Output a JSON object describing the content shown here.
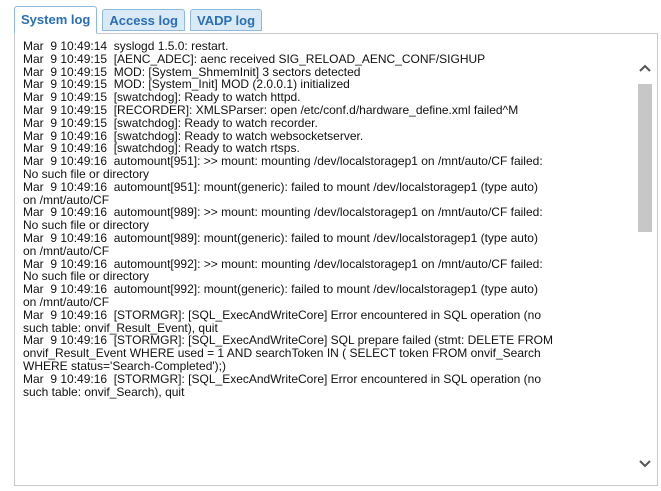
{
  "tabs": [
    {
      "label": "System log",
      "active": true
    },
    {
      "label": "Access log",
      "active": false
    },
    {
      "label": "VADP log",
      "active": false
    }
  ],
  "log_lines": [
    "Mar  9 10:49:14  syslogd 1.5.0: restart.",
    "Mar  9 10:49:15  [AENC_ADEC]: aenc received SIG_RELOAD_AENC_CONF/SIGHUP",
    "Mar  9 10:49:15  MOD: [System_ShmemInit] 3 sectors detected",
    "Mar  9 10:49:15  MOD: [System_Init] MOD (2.0.0.1) initialized",
    "Mar  9 10:49:15  [swatchdog]: Ready to watch httpd.",
    "Mar  9 10:49:15  [RECORDER]: XMLSParser: open /etc/conf.d/hardware_define.xml failed^M",
    "Mar  9 10:49:15  [swatchdog]: Ready to watch recorder.",
    "Mar  9 10:49:16  [swatchdog]: Ready to watch websocketserver.",
    "Mar  9 10:49:16  [swatchdog]: Ready to watch rtsps.",
    "Mar  9 10:49:16  automount[951]: >> mount: mounting /dev/localstoragep1 on /mnt/auto/CF failed:",
    "No such file or directory",
    "Mar  9 10:49:16  automount[951]: mount(generic): failed to mount /dev/localstoragep1 (type auto)",
    "on /mnt/auto/CF",
    "Mar  9 10:49:16  automount[989]: >> mount: mounting /dev/localstoragep1 on /mnt/auto/CF failed:",
    "No such file or directory",
    "Mar  9 10:49:16  automount[989]: mount(generic): failed to mount /dev/localstoragep1 (type auto)",
    "on /mnt/auto/CF",
    "Mar  9 10:49:16  automount[992]: >> mount: mounting /dev/localstoragep1 on /mnt/auto/CF failed:",
    "No such file or directory",
    "Mar  9 10:49:16  automount[992]: mount(generic): failed to mount /dev/localstoragep1 (type auto)",
    "on /mnt/auto/CF",
    "Mar  9 10:49:16  [STORMGR]: [SQL_ExecAndWriteCore] Error encountered in SQL operation (no",
    "such table: onvif_Result_Event), quit",
    "Mar  9 10:49:16  [STORMGR]: [SQL_ExecAndWriteCore] SQL prepare failed (stmt: DELETE FROM",
    "onvif_Result_Event WHERE used = 1 AND searchToken IN ( SELECT token FROM onvif_Search",
    "WHERE status='Search-Completed');)",
    "Mar  9 10:49:16  [STORMGR]: [SQL_ExecAndWriteCore] Error encountered in SQL operation (no",
    "such table: onvif_Search), quit"
  ],
  "icons": {
    "scroll_up": "chevron-up-icon",
    "scroll_down": "chevron-down-icon"
  },
  "colors": {
    "tab_text": "#2a6fb5",
    "tab_bg": "#d9e9f6",
    "tab_border": "#8fb9dd",
    "scroll_thumb": "#c7c7c7"
  }
}
